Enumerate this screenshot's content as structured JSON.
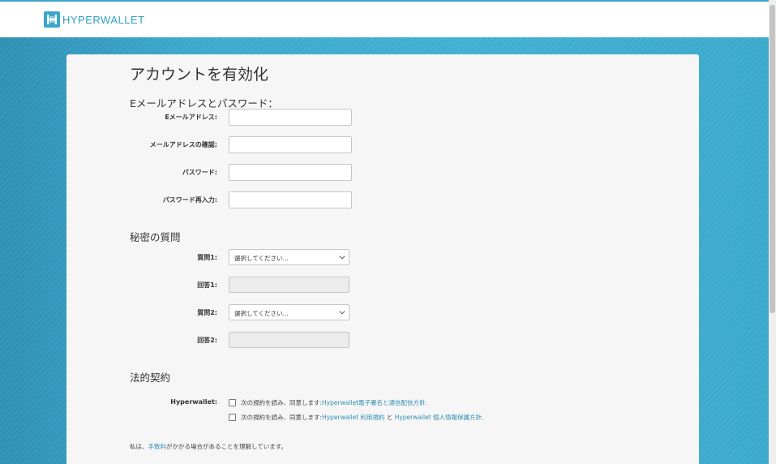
{
  "header": {
    "logo_text": "HYPERWALLET",
    "brand_color": "#3aa6c9",
    "logo_icon": "hyperwallet-logo-icon"
  },
  "page": {
    "title": "アカウントを有効化"
  },
  "credentials": {
    "section_title": "Eメールアドレスとパスワード：",
    "email_label": "Eメールアドレス:",
    "email_confirm_label": "メールアドレスの確認:",
    "password_label": "パスワード:",
    "password_confirm_label": "パスワード再入力:",
    "email_value": "",
    "email_confirm_value": "",
    "password_value": "",
    "password_confirm_value": ""
  },
  "security": {
    "section_title": "秘密の質問",
    "q1_label": "質問1:",
    "q1_selected": "選択してください...",
    "a1_label": "回答1:",
    "a1_value": "",
    "q2_label": "質問2:",
    "q2_selected": "選択してください...",
    "a2_label": "回答2:",
    "a2_value": ""
  },
  "legal": {
    "section_title": "法的契約",
    "label": "Hyperwallet:",
    "agreement1_prefix": "次の規約を読み、同意します: ",
    "agreement1_link": "Hyperwallet電子署名と通信配信方針.",
    "agreement1_checked": false,
    "agreement2_prefix": "次の規約を読み、同意します: ",
    "agreement2_link1": "Hyperwallet 利用規約",
    "agreement2_and": " と ",
    "agreement2_link2": "Hyperwallet 個人情報保護方針.",
    "agreement2_checked": false,
    "fee_prefix": "私は、",
    "fee_link": "手数料",
    "fee_suffix": "がかかる場合があることを理解しています。"
  }
}
